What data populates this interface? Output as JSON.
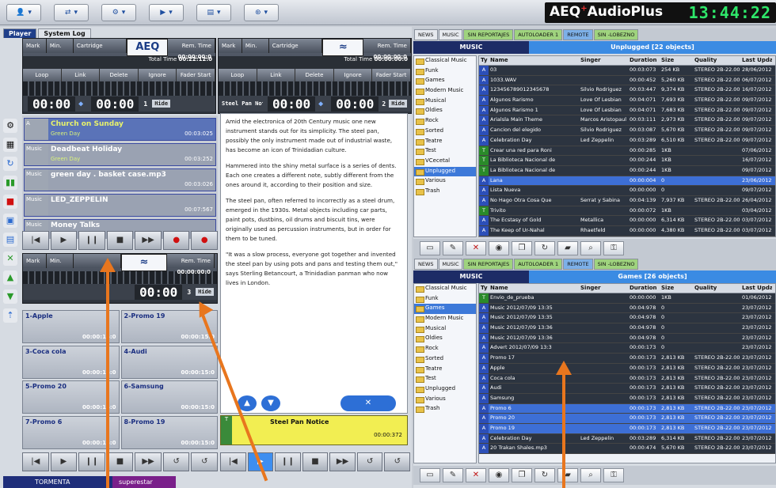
{
  "topbar": {
    "brand": "AEQ",
    "brand_product": "AudioPlus",
    "clock": "13:44:22",
    "buttons": [
      {
        "icon": "user-icon"
      },
      {
        "icon": "switch-icon"
      },
      {
        "icon": "gear-icon"
      },
      {
        "icon": "play-icon"
      },
      {
        "icon": "screen-icon"
      },
      {
        "icon": "network-icon"
      }
    ]
  },
  "left": {
    "tabs": [
      "Player",
      "System Log"
    ],
    "player1": {
      "mark_a": "Mark",
      "mark_b": "Beat",
      "min_label": "Min.",
      "cartridge_label": "Cartridge",
      "logo": "AEQ",
      "rem_time_label": "Rem. Time",
      "rem_time": "00:00:00:0",
      "total_time_label": "Total Time",
      "total_time": "00:22:12:0",
      "controls": [
        "Loop",
        "Link",
        "Delete",
        "Ignore",
        "Fader Start"
      ],
      "time_a": "00:00",
      "time_b": "00:00",
      "index": "1",
      "hide": "Hide"
    },
    "player2": {
      "mark_a": "Mark",
      "mark_b": "Beat",
      "min_label": "Min.",
      "cartridge_label": "Cartridge",
      "rem_time_label": "Rem. Time",
      "rem_time": "00:00:00:0",
      "total_time_label": "Total Time",
      "total_time": "00:00:00:0",
      "controls": [
        "Loop",
        "Link",
        "Delete",
        "Ignore",
        "Fader Start"
      ],
      "notice": "Steel Pan Notice",
      "time_a": "00:00",
      "time_b": "00:00",
      "index": "2",
      "hide": "Hide"
    },
    "playlist": [
      {
        "tag": "A",
        "title": "Church on Sunday",
        "sub": "Green Day",
        "dur": "00:03:025",
        "cued": true
      },
      {
        "tag": "Music",
        "title": "Deadbeat Holiday",
        "sub": "Green Day",
        "dur": "00:03:252",
        "cued": false
      },
      {
        "tag": "Music",
        "title": "green day . basket case.mp3",
        "sub": "",
        "dur": "00:03:026",
        "cued": false
      },
      {
        "tag": "Music",
        "title": "LED_ZEPPELIN",
        "sub": "",
        "dur": "00:07:567",
        "cued": false
      },
      {
        "tag": "Music",
        "title": "Money Talks",
        "sub": "",
        "dur": "",
        "cued": false
      }
    ],
    "player3": {
      "mark_a": "Mark",
      "mark_b": "Beat",
      "min_label": "Min.",
      "rem_time_label": "Rem. Time",
      "rem_time": "00:00:00:0",
      "time": "00:00",
      "index": "3",
      "hide": "Hide"
    },
    "carts": [
      {
        "title": "1-Apple",
        "dur": "00:00:15:0"
      },
      {
        "title": "2-Promo 19",
        "dur": "00:00:15:0"
      },
      {
        "title": "3-Coca cola",
        "dur": "00:00:15:0"
      },
      {
        "title": "4-Audi",
        "dur": "00:00:15:0"
      },
      {
        "title": "5-Promo 20",
        "dur": "00:00:15:0"
      },
      {
        "title": "6-Samsung",
        "dur": "00:00:15:0"
      },
      {
        "title": "7-Promo 6",
        "dur": "00:00:15:0"
      },
      {
        "title": "8-Promo 19",
        "dur": "00:00:15:0"
      }
    ],
    "status_left": "TORMENTA",
    "status_right": "superestar",
    "notice_card": {
      "title": "Steel Pan Notice",
      "dur": "00:00:372"
    }
  },
  "text": {
    "paragraphs": [
      "Amid the electronica of 20th Century music one new instrument stands out for its simplicity. The steel pan, possibly the only instrument made out of industrial waste, has become an icon of Trinidadian culture.",
      "Hammered into the shiny metal surface is a series of dents. Each one creates a different note, subtly different from the ones around it, according to their position and size.",
      "The steel pan, often referred to incorrectly as a steel drum, emerged in the 1930s. Metal objects including car parts, paint pots, dustbins, oil drums and biscuit tins, were originally used as percussion instruments, but in order for them to be tuned.",
      "\"It was a slow process, everyone got together and invented the steel pan by using pots and pans and testing them out,\" says Sterling Betancourt, a Trinidadian panman who now lives in London."
    ]
  },
  "right": {
    "tabs1": [
      {
        "label": "NEWS",
        "c": ""
      },
      {
        "label": "MUSIC",
        "c": ""
      },
      {
        "label": "SIN REPORTAJES",
        "c": "g"
      },
      {
        "label": "AUTOLOADER 1",
        "c": "g"
      },
      {
        "label": "REMOTE",
        "c": "b"
      },
      {
        "label": "SIN -LOBEZNO",
        "c": "g"
      }
    ],
    "top": {
      "category": "MUSIC",
      "folder_info": "Unplugged [22 objects]",
      "columns": [
        "Ty",
        "Name",
        "Singer",
        "Duration",
        "Size",
        "Quality",
        "Last Updat"
      ],
      "tree": [
        "Classical Music",
        "Funk",
        "Games",
        "Modern Music",
        "Musical",
        "Oldies",
        "Rock",
        "Sorted",
        "Teatre",
        "Test",
        "VCecetal",
        "Unplugged",
        "Various",
        "Trash"
      ],
      "tree_selected": 11,
      "rows": [
        {
          "ty": "A",
          "name": "03",
          "singer": "",
          "dur": "00:03:073",
          "size": "254 KB",
          "q": "STEREO 2B-22.000",
          "lu": "28/06/2012",
          "sel": false
        },
        {
          "ty": "A",
          "name": "1033.WAV",
          "singer": "",
          "dur": "00:00:452",
          "size": "5,260 KB",
          "q": "STEREO 2B-22.000",
          "lu": "06/07/2012",
          "sel": false
        },
        {
          "ty": "A",
          "name": "123456789012345678",
          "singer": "Silvio Rodriguez",
          "dur": "00:03:447",
          "size": "9,374 KB",
          "q": "STEREO 2B-22.000",
          "lu": "16/07/2012",
          "sel": false
        },
        {
          "ty": "A",
          "name": "Algunos Rarismo",
          "singer": "Love Of Lesbian",
          "dur": "00:04:071",
          "size": "7,693 KB",
          "q": "STEREO 2B-22.000",
          "lu": "09/07/2012",
          "sel": false
        },
        {
          "ty": "A",
          "name": "Algunos Rarismo 1",
          "singer": "Love Of Lesbian",
          "dur": "00:04:071",
          "size": "7,683 KB",
          "q": "STEREO 2B-22.000",
          "lu": "09/07/2012",
          "sel": false
        },
        {
          "ty": "A",
          "name": "Arialsla Main Theme",
          "singer": "Marcos Aristopaul",
          "dur": "00:03:111",
          "size": "2,973 KB",
          "q": "STEREO 2B-22.000",
          "lu": "09/07/2012",
          "sel": false
        },
        {
          "ty": "A",
          "name": "Cancion del elegido",
          "singer": "Silvio Rodriguez",
          "dur": "00:03:087",
          "size": "5,670 KB",
          "q": "STEREO 2B-22.000",
          "lu": "09/07/2012",
          "sel": false
        },
        {
          "ty": "A",
          "name": "Celebration Day",
          "singer": "Led Zeppelin",
          "dur": "00:03:289",
          "size": "6,510 KB",
          "q": "STEREO 2B-22.000",
          "lu": "09/07/2012",
          "sel": false
        },
        {
          "ty": "T",
          "name": "Crear una red para Roni",
          "singer": "",
          "dur": "00:00:285",
          "size": "1KB",
          "q": "",
          "lu": "07/06/2012",
          "sel": false
        },
        {
          "ty": "T",
          "name": "La Biblioteca Nacional de",
          "singer": "",
          "dur": "00:00:244",
          "size": "1KB",
          "q": "",
          "lu": "16/07/2012",
          "sel": false
        },
        {
          "ty": "T",
          "name": "La Biblioteca Nacional de",
          "singer": "",
          "dur": "00:00:244",
          "size": "1KB",
          "q": "",
          "lu": "09/07/2012",
          "sel": false
        },
        {
          "ty": "A",
          "name": "Lana",
          "singer": "",
          "dur": "00:00:004",
          "size": "0",
          "q": "",
          "lu": "23/06/2012",
          "sel": true
        },
        {
          "ty": "A",
          "name": "Lista Nueva",
          "singer": "",
          "dur": "00:00:000",
          "size": "0",
          "q": "",
          "lu": "09/07/2012",
          "sel": false
        },
        {
          "ty": "A",
          "name": "No Hago Otra Cosa Que",
          "singer": "Serrat y Sabina",
          "dur": "00:04:139",
          "size": "7,937 KB",
          "q": "STEREO 2B-22.000",
          "lu": "26/04/2012",
          "sel": false
        },
        {
          "ty": "T",
          "name": "Trivito",
          "singer": "",
          "dur": "00:00:072",
          "size": "1KB",
          "q": "",
          "lu": "03/04/2012",
          "sel": false
        },
        {
          "ty": "A",
          "name": "The Ecstasy of Gold",
          "singer": "Metallica",
          "dur": "00:00:000",
          "size": "6,314 KB",
          "q": "STEREO 2B-22.000",
          "lu": "03/07/2012",
          "sel": false
        },
        {
          "ty": "A",
          "name": "The Keep of Ur-Nahal",
          "singer": "Rhaetfeld",
          "dur": "00:00:000",
          "size": "4,380 KB",
          "q": "STEREO 2B-22.000",
          "lu": "03/07/2012",
          "sel": false
        }
      ]
    },
    "tabs2": [
      {
        "label": "NEWS",
        "c": ""
      },
      {
        "label": "MUSIC",
        "c": ""
      },
      {
        "label": "SIN REPORTAJES",
        "c": "g"
      },
      {
        "label": "AUTOLOADER 1",
        "c": "g"
      },
      {
        "label": "REMOTE",
        "c": "b"
      },
      {
        "label": "SIN -LOBEZNO",
        "c": "g"
      }
    ],
    "bottom": {
      "category": "MUSIC",
      "folder_info": "Games [26 objects]",
      "columns": [
        "Ty",
        "Name",
        "Singer",
        "Duration",
        "Size",
        "Quality",
        "Last Updat"
      ],
      "tree": [
        "Classical Music",
        "Funk",
        "Games",
        "Modern Music",
        "Musical",
        "Oldies",
        "Rock",
        "Sorted",
        "Teatre",
        "Test",
        "Unplugged",
        "Various",
        "Trash"
      ],
      "tree_selected": 2,
      "rows": [
        {
          "ty": "T",
          "name": "Envio_de_prueba",
          "singer": "",
          "dur": "00:00:000",
          "size": "1KB",
          "q": "",
          "lu": "01/06/2012",
          "sel": false
        },
        {
          "ty": "A",
          "name": "Music 2012/07/09 13:35",
          "singer": "",
          "dur": "00:04:978",
          "size": "0",
          "q": "",
          "lu": "23/07/2012",
          "sel": false
        },
        {
          "ty": "A",
          "name": "Music 2012/07/09 13:35",
          "singer": "",
          "dur": "00:04:978",
          "size": "0",
          "q": "",
          "lu": "23/07/2012",
          "sel": false
        },
        {
          "ty": "A",
          "name": "Music 2012/07/09 13:36",
          "singer": "",
          "dur": "00:04:978",
          "size": "0",
          "q": "",
          "lu": "23/07/2012",
          "sel": false
        },
        {
          "ty": "A",
          "name": "Music 2012/07/09 13:36",
          "singer": "",
          "dur": "00:04:978",
          "size": "0",
          "q": "",
          "lu": "23/07/2012",
          "sel": false
        },
        {
          "ty": "A",
          "name": "Advert 2012/07/09 13:3",
          "singer": "",
          "dur": "00:00:173",
          "size": "0",
          "q": "",
          "lu": "23/07/2012",
          "sel": false
        },
        {
          "ty": "A",
          "name": "Promo 17",
          "singer": "",
          "dur": "00:00:173",
          "size": "2,813 KB",
          "q": "STEREO 2B-22.000",
          "lu": "23/07/2012",
          "sel": false
        },
        {
          "ty": "A",
          "name": "Apple",
          "singer": "",
          "dur": "00:00:173",
          "size": "2,813 KB",
          "q": "STEREO 2B-22.000",
          "lu": "23/07/2012",
          "sel": false
        },
        {
          "ty": "A",
          "name": "Coca cola",
          "singer": "",
          "dur": "00:00:173",
          "size": "2,813 KB",
          "q": "STEREO 2B-22.000",
          "lu": "23/07/2012",
          "sel": false
        },
        {
          "ty": "A",
          "name": "Audi",
          "singer": "",
          "dur": "00:00:173",
          "size": "2,813 KB",
          "q": "STEREO 2B-22.000",
          "lu": "23/07/2012",
          "sel": false
        },
        {
          "ty": "A",
          "name": "Samsung",
          "singer": "",
          "dur": "00:00:173",
          "size": "2,813 KB",
          "q": "STEREO 2B-22.000",
          "lu": "23/07/2012",
          "sel": false
        },
        {
          "ty": "A",
          "name": "Promo 6",
          "singer": "",
          "dur": "00:00:173",
          "size": "2,813 KB",
          "q": "STEREO 2B-22.000",
          "lu": "23/07/2012",
          "sel": true
        },
        {
          "ty": "A",
          "name": "Promo 20",
          "singer": "",
          "dur": "00:00:173",
          "size": "2,813 KB",
          "q": "STEREO 2B-22.000",
          "lu": "23/07/2012",
          "sel": true
        },
        {
          "ty": "A",
          "name": "Promo 19",
          "singer": "",
          "dur": "00:00:173",
          "size": "2,813 KB",
          "q": "STEREO 2B-22.000",
          "lu": "23/07/2012",
          "sel": true
        },
        {
          "ty": "A",
          "name": "Celebration Day",
          "singer": "Led Zeppelin",
          "dur": "00:03:289",
          "size": "6,314 KB",
          "q": "STEREO 2B-22.000",
          "lu": "23/07/2012",
          "sel": false
        },
        {
          "ty": "A",
          "name": "20 Trakan Shales.mp3",
          "singer": "",
          "dur": "00:00:474",
          "size": "5,670 KB",
          "q": "STEREO 2B-22.000",
          "lu": "23/07/2012",
          "sel": false
        }
      ]
    },
    "toolbar": [
      "new-icon",
      "edit-icon",
      "delete-icon",
      "record-icon",
      "copy-icon",
      "refresh-icon",
      "folder-icon",
      "search-icon",
      "lock-icon"
    ],
    "colors": {
      "selection": "#3d79d9",
      "tab_green": "#9fd37e",
      "tab_blue": "#7db0e8",
      "clock": "#2ee86a",
      "annotation_arrow": "#e8761e"
    }
  }
}
